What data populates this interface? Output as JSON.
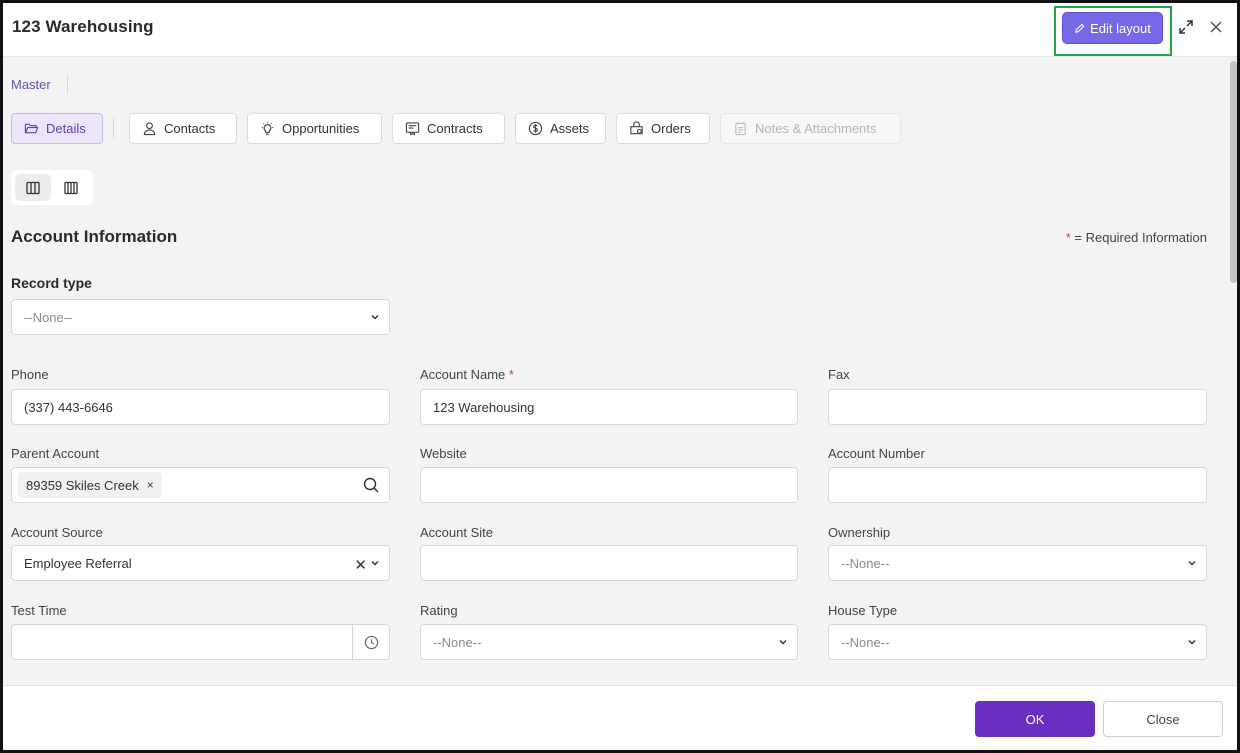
{
  "header": {
    "title": "123 Warehousing",
    "edit_layout_label": "Edit layout"
  },
  "breadcrumb": {
    "label": "Master"
  },
  "tabs": [
    {
      "label": "Details",
      "icon": "folder-open-icon",
      "active": true
    },
    {
      "label": "Contacts",
      "icon": "user-icon"
    },
    {
      "label": "Opportunities",
      "icon": "lightbulb-icon"
    },
    {
      "label": "Contracts",
      "icon": "contract-icon"
    },
    {
      "label": "Assets",
      "icon": "dollar-circle-icon"
    },
    {
      "label": "Orders",
      "icon": "cart-icon"
    },
    {
      "label": "Notes & Attachments",
      "icon": "notes-icon",
      "disabled": true
    }
  ],
  "section": {
    "title": "Account Information",
    "required_star": "*",
    "required_text": "= Required Information"
  },
  "record_type": {
    "label": "Record type",
    "value": "--None--"
  },
  "fields": {
    "phone": {
      "label": "Phone",
      "value": "(337) 443-6646"
    },
    "account_name": {
      "label": "Account Name",
      "required": "*",
      "value": "123 Warehousing"
    },
    "fax": {
      "label": "Fax",
      "value": ""
    },
    "parent_account": {
      "label": "Parent Account",
      "tag": "89359 Skiles Creek",
      "tag_remove": "×"
    },
    "website": {
      "label": "Website",
      "value": ""
    },
    "account_number": {
      "label": "Account Number",
      "value": ""
    },
    "account_source": {
      "label": "Account Source",
      "value": "Employee Referral",
      "clear": "✕"
    },
    "account_site": {
      "label": "Account Site",
      "value": ""
    },
    "ownership": {
      "label": "Ownership",
      "value": "--None--"
    },
    "test_time": {
      "label": "Test Time",
      "value": ""
    },
    "rating": {
      "label": "Rating",
      "value": "--None--"
    },
    "house_type": {
      "label": "House Type",
      "value": "--None--"
    }
  },
  "footer": {
    "ok_label": "OK",
    "close_label": "Close"
  },
  "colors": {
    "accent": "#6a2fc0",
    "edit_button": "#7569e8",
    "highlight": "#22a645",
    "required": "#e03b3b"
  }
}
